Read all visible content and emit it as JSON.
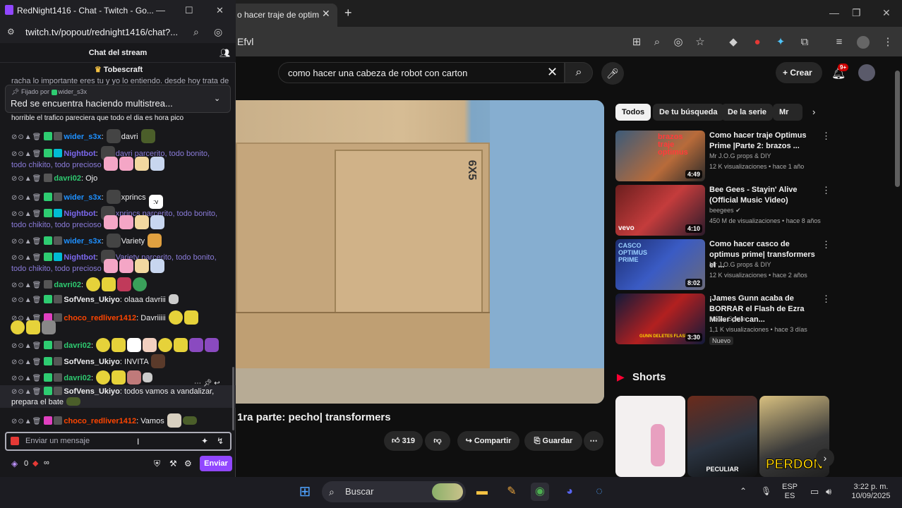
{
  "twitch": {
    "window_title": "RedNight1416 - Chat - Twitch - Go...",
    "url": "twitch.tv/popout/rednight1416/chat?...",
    "header_title": "Chat del stream",
    "top_user": "Tobescraft",
    "scroll_text_top": "racha lo importante eres tu y yo lo entiendo. desde hoy trata de",
    "pinned_by": "Fijado por",
    "pinned_by_user": "wider_s3x",
    "pinned_text": "Red se encuentra haciendo multistrea...",
    "messages": [
      {
        "user": "",
        "text": "horrible el trafico pareciera que todo el dia es hora pico",
        "user_color": "#efeff1",
        "text_color": "#efeff1"
      },
      {
        "user": "wider_s3x",
        "text": "davri",
        "user_color": "#1e90ff",
        "text_color": "#efeff1"
      },
      {
        "user": "Nightbot",
        "text": "davri parcerito, todo bonito, todo chikito, todo precioso",
        "user_color": "#7b68ee",
        "text_color": "#8a7bd9"
      },
      {
        "user": "davri02",
        "text": "Ojo",
        "user_color": "#2ecc71",
        "text_color": "#efeff1"
      },
      {
        "user": "wider_s3x",
        "text": "xprincs",
        "user_color": "#1e90ff",
        "text_color": "#efeff1",
        "emote_text": ":v"
      },
      {
        "user": "Nightbot",
        "text": "xprincs parcerito, todo bonito, todo chikito, todo precioso",
        "user_color": "#7b68ee",
        "text_color": "#8a7bd9"
      },
      {
        "user": "wider_s3x",
        "text": "Variety",
        "user_color": "#1e90ff",
        "text_color": "#efeff1"
      },
      {
        "user": "Nightbot",
        "text": "Variety parcerito, todo bonito, todo chikito, todo precioso",
        "user_color": "#7b68ee",
        "text_color": "#8a7bd9"
      },
      {
        "user": "davri02",
        "text": "",
        "user_color": "#2ecc71",
        "text_color": "#efeff1"
      },
      {
        "user": "SofVens_Ukiyo",
        "text": "olaaa davriii",
        "user_color": "#efeff1",
        "text_color": "#efeff1"
      },
      {
        "user": "choco_redliver1412",
        "text": "Davriiiii",
        "user_color": "#ff4500",
        "text_color": "#efeff1"
      },
      {
        "user": "davri02",
        "text": "",
        "user_color": "#2ecc71",
        "text_color": "#efeff1"
      },
      {
        "user": "SofVens_Ukiyo",
        "text": "INVITA",
        "user_color": "#efeff1",
        "text_color": "#efeff1"
      },
      {
        "user": "davri02",
        "text": "",
        "user_color": "#2ecc71",
        "text_color": "#efeff1"
      },
      {
        "user": "SofVens_Ukiyo",
        "text": "todos vamos a vandalizar, prepara el bate",
        "user_color": "#efeff1",
        "text_color": "#efeff1"
      },
      {
        "user": "choco_redliver1412",
        "text": "Vamos",
        "user_color": "#ff4500",
        "text_color": "#efeff1"
      }
    ],
    "input_placeholder": "Enviar un mensaje",
    "points": "0",
    "infinity": "∞",
    "send_label": "Enviar"
  },
  "chrome": {
    "tab_title": "o hacer traje de optim",
    "url_fragment": "Efvl",
    "window_minimize": "—",
    "window_restore": "❐",
    "window_close": "✕"
  },
  "youtube": {
    "search_value": "como hacer una cabeza de robot con carton",
    "create_label": "Crear",
    "notif_count": "9+",
    "video_label": "6X5",
    "video_title": "1ra parte: pecho| transformers",
    "likes": "319",
    "share_label": "Compartir",
    "save_label": "Guardar",
    "chips": [
      "Todos",
      "De tu búsqueda",
      "De la serie",
      "Mr J.O"
    ],
    "recs": [
      {
        "title": "Como hacer traje Optimus Prime |Parte 2: brazos ...",
        "channel": "Mr J.O.G props & DIY",
        "meta": "12 K visualizaciones • hace 1 año",
        "duration": "4:49",
        "thumb_text": "brazos traje optimus"
      },
      {
        "title": "Bee Gees - Stayin' Alive (Official Music Video)",
        "channel": "beegees",
        "meta": "450 M de visualizaciones • hace 8 años",
        "duration": "4:10",
        "thumb_text": "vevo"
      },
      {
        "title": "Como hacer casco de optimus prime| transformers el ...",
        "channel": "Mr J.O.G props & DIY",
        "meta": "12 K visualizaciones • hace 2 años",
        "duration": "8:02",
        "thumb_text": "CASCO OPTIMUS PRIME"
      },
      {
        "title": "¡James Gunn acaba de BORRAR el Flash de Ezra Miller del can...",
        "channel": "Movie Spoiler",
        "meta": "1,1 K visualizaciones • hace 3 días",
        "duration": "3:30",
        "badge": "Nuevo",
        "thumb_text": "GUNN DELETES FLASH"
      }
    ],
    "shorts_title": "Shorts",
    "shorts": [
      {
        "label": ""
      },
      {
        "label": "PECULIAR"
      },
      {
        "label": "PERDON"
      }
    ]
  },
  "taskbar": {
    "search_placeholder": "Buscar",
    "lang_top": "ESP",
    "lang_bottom": "ES",
    "time": "3:22 p. m.",
    "date": "10/09/2025"
  },
  "colors": {
    "twitch_purple": "#9147ff",
    "youtube_red": "#ff0000"
  }
}
